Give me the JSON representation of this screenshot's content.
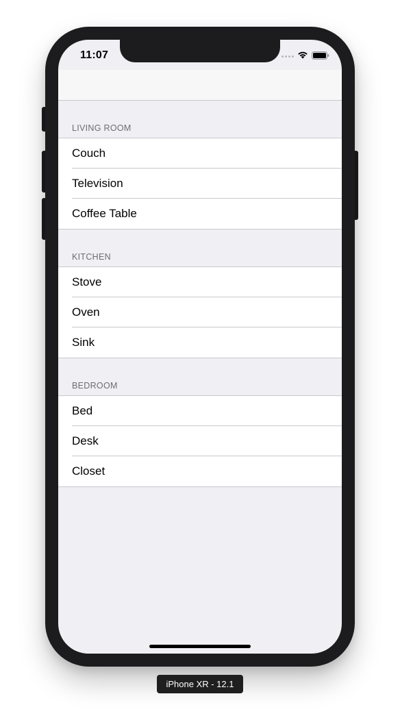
{
  "status_bar": {
    "time": "11:07"
  },
  "icons": {
    "signal": "signal-dots-icon",
    "wifi": "wifi-icon",
    "battery": "battery-icon"
  },
  "sections": [
    {
      "header": "LIVING ROOM",
      "rows": [
        "Couch",
        "Television",
        "Coffee Table"
      ]
    },
    {
      "header": "KITCHEN",
      "rows": [
        "Stove",
        "Oven",
        "Sink"
      ]
    },
    {
      "header": "BEDROOM",
      "rows": [
        "Bed",
        "Desk",
        "Closet"
      ]
    }
  ],
  "simulator": {
    "device_label": "iPhone XR - 12.1"
  },
  "colors": {
    "grouped_background": "#efeff4",
    "cell_background": "#ffffff",
    "separator": "#c8c7cc",
    "header_text": "#6d6d72",
    "device_frame": "#1c1c1e"
  }
}
